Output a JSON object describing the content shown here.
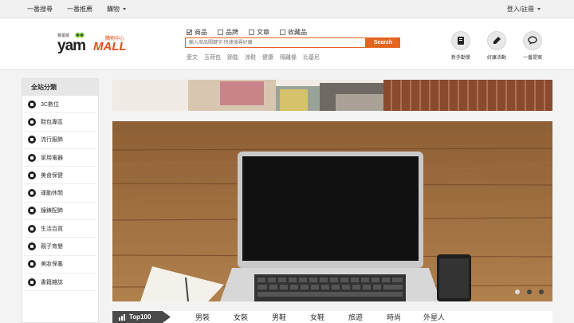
{
  "topnav": {
    "items": [
      "一番搜尋",
      "一番推薦",
      "購物"
    ],
    "login": "登入/註冊"
  },
  "logo": {
    "sub": "蕃薯藤",
    "yam": "yam",
    "mall": "MALL",
    "tag": "購物中心"
  },
  "search": {
    "filters": [
      {
        "label": "商品",
        "checked": true
      },
      {
        "label": "品牌",
        "checked": false
      },
      {
        "label": "文章",
        "checked": false
      },
      {
        "label": "收藏品",
        "checked": false
      }
    ],
    "placeholder": "輸入商品關鍵字,快速搜尋好康",
    "button": "Search",
    "hotwords": [
      "愛文",
      "玉荷包",
      "節能",
      "涼鞋",
      "健康",
      "隔離條",
      "比基尼"
    ]
  },
  "quicklinks": [
    {
      "label": "新手勸學",
      "icon": "book-icon"
    },
    {
      "label": "好康活動",
      "icon": "pen-icon"
    },
    {
      "label": "一番提案",
      "icon": "chat-bubble-icon"
    }
  ],
  "sidebar": {
    "title": "全站分類",
    "categories": [
      "3C數位",
      "鞋包專區",
      "流行服飾",
      "家用電器",
      "美食保健",
      "運動休閒",
      "鐘錶配飾",
      "生活百貨",
      "親子育嬰",
      "美妝保養",
      "書籍雜誌"
    ]
  },
  "hero": {
    "slides": 3,
    "active": 0,
    "laptop_brand": "MacBook Air"
  },
  "top100": {
    "label": "Top100",
    "tabs": [
      "男裝",
      "女裝",
      "男鞋",
      "女鞋",
      "旅遊",
      "時尚",
      "外星人"
    ]
  },
  "colors": {
    "accent": "#e2651f",
    "dark": "#4a4a4a"
  }
}
